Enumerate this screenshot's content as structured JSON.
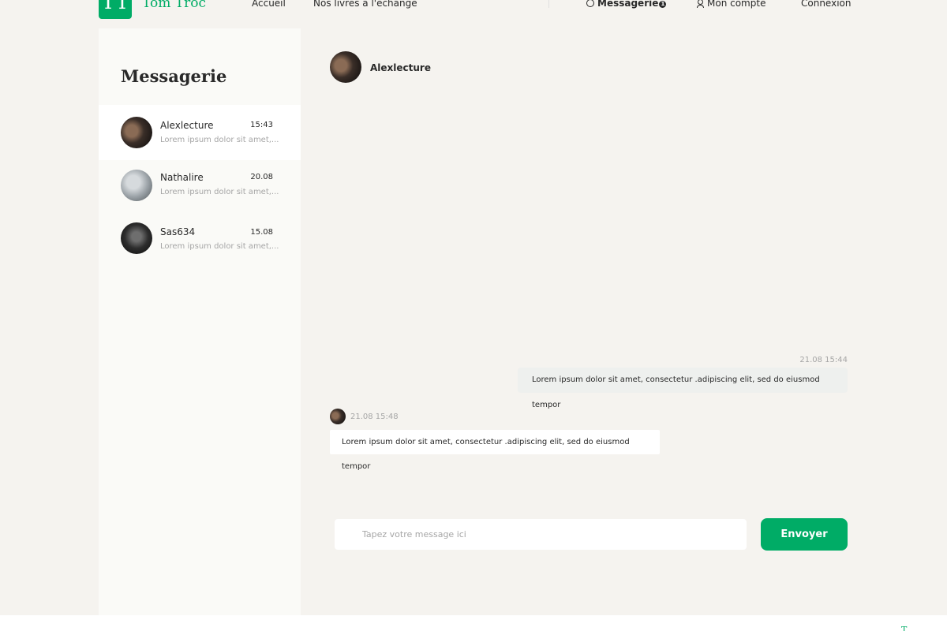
{
  "header": {
    "logo_initials": "TT",
    "logo_text": "Tom Troc",
    "nav": {
      "home": "Accueil",
      "books": "Nos livres à l'échange"
    },
    "messaging": {
      "label": "Messagerie",
      "badge": "1"
    },
    "account": "Mon compte",
    "login": "Connexion"
  },
  "sidebar": {
    "title": "Messagerie",
    "conversations": [
      {
        "name": "Alexlecture",
        "time": "15:43",
        "preview": "Lorem ipsum dolor sit amet,..."
      },
      {
        "name": "Nathalire",
        "time": "20.08",
        "preview": "Lorem ipsum dolor sit amet,..."
      },
      {
        "name": "Sas634",
        "time": "15.08",
        "preview": "Lorem ipsum dolor sit amet,..."
      }
    ]
  },
  "chat": {
    "contact_name": "Alexlecture",
    "messages": [
      {
        "direction": "outgoing",
        "meta": "21.08 15:44",
        "text": "Lorem ipsum dolor sit amet, consectetur .adipiscing elit, sed do eiusmod tempor"
      },
      {
        "direction": "incoming",
        "meta": "21.08 15:48",
        "text": "Lorem ipsum dolor sit amet, consectetur .adipiscing elit, sed do eiusmod tempor"
      }
    ],
    "input_placeholder": "Tapez votre message ici",
    "send_label": "Envoyer"
  },
  "colors": {
    "accent": "#00ac66",
    "background": "#f5f3ef",
    "text": "#292929",
    "muted": "#a6a6a6"
  }
}
